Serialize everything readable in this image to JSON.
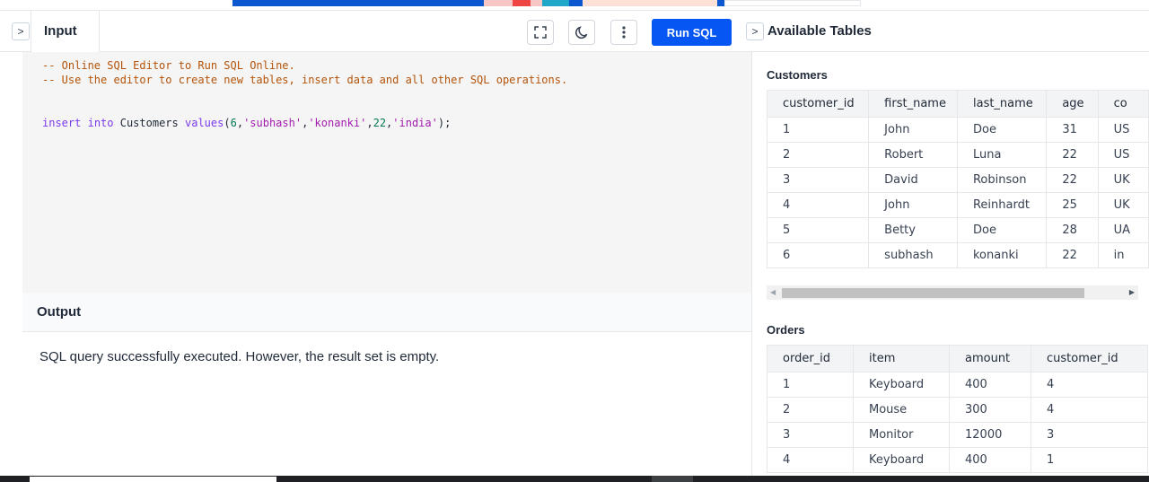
{
  "input_panel": {
    "tab_label": "Input",
    "run_button": "Run SQL",
    "collapse_glyph": ">",
    "code_lines": [
      {
        "type": "comment",
        "text": "-- Online SQL Editor to Run SQL Online."
      },
      {
        "type": "comment",
        "text": "-- Use the editor to create new tables, insert data and all other SQL operations."
      },
      {
        "type": "blank",
        "text": ""
      },
      {
        "type": "blank",
        "text": ""
      },
      {
        "type": "code",
        "text": "insert into Customers values(6,'subhash','konanki',22,'india');"
      }
    ]
  },
  "output_panel": {
    "title": "Output",
    "message": "SQL query successfully executed. However, the result set is empty."
  },
  "tables_panel": {
    "title": "Available Tables",
    "customers": {
      "name": "Customers",
      "columns": [
        "customer_id",
        "first_name",
        "last_name",
        "age",
        "co"
      ],
      "rows": [
        [
          "1",
          "John",
          "Doe",
          "31",
          "US"
        ],
        [
          "2",
          "Robert",
          "Luna",
          "22",
          "US"
        ],
        [
          "3",
          "David",
          "Robinson",
          "22",
          "UK"
        ],
        [
          "4",
          "John",
          "Reinhardt",
          "25",
          "UK"
        ],
        [
          "5",
          "Betty",
          "Doe",
          "28",
          "UA"
        ],
        [
          "6",
          "subhash",
          "konanki",
          "22",
          "in"
        ]
      ]
    },
    "orders": {
      "name": "Orders",
      "columns": [
        "order_id",
        "item",
        "amount",
        "customer_id"
      ],
      "rows": [
        [
          "1",
          "Keyboard",
          "400",
          "4"
        ],
        [
          "2",
          "Mouse",
          "300",
          "4"
        ],
        [
          "3",
          "Monitor",
          "12000",
          "3"
        ],
        [
          "4",
          "Keyboard",
          "400",
          "1"
        ]
      ]
    }
  },
  "colors": {
    "accent": "#0556f3",
    "editor_bg": "#f5f5f5",
    "comment": "#b45309"
  }
}
